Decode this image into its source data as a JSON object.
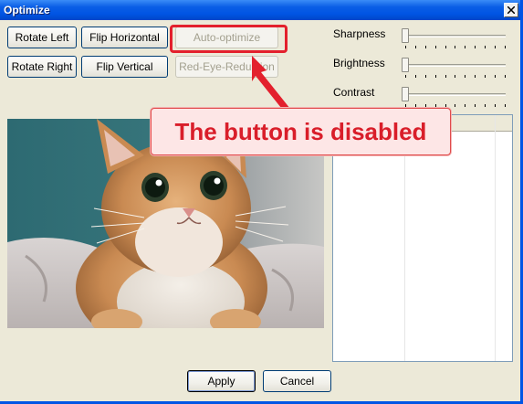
{
  "window": {
    "title": "Optimize",
    "close_icon": "close-x-icon"
  },
  "buttons": {
    "rotate_left": "Rotate Left",
    "flip_horizontal": "Flip Horizontal",
    "auto_optimize": "Auto-optimize",
    "rotate_right": "Rotate Right",
    "flip_vertical": "Flip Vertical",
    "red_eye_reduction": "Red-Eye-Reduction",
    "apply": "Apply",
    "cancel": "Cancel"
  },
  "sliders": [
    {
      "label": "Sharpness",
      "value": 0
    },
    {
      "label": "Brightness",
      "value": 0
    },
    {
      "label": "Contrast",
      "value": 0
    }
  ],
  "annotation": {
    "text": "The button is disabled",
    "color": "#d91e2a",
    "border_color": "#e3202d"
  },
  "photo": {
    "subject": "cat-photo"
  }
}
